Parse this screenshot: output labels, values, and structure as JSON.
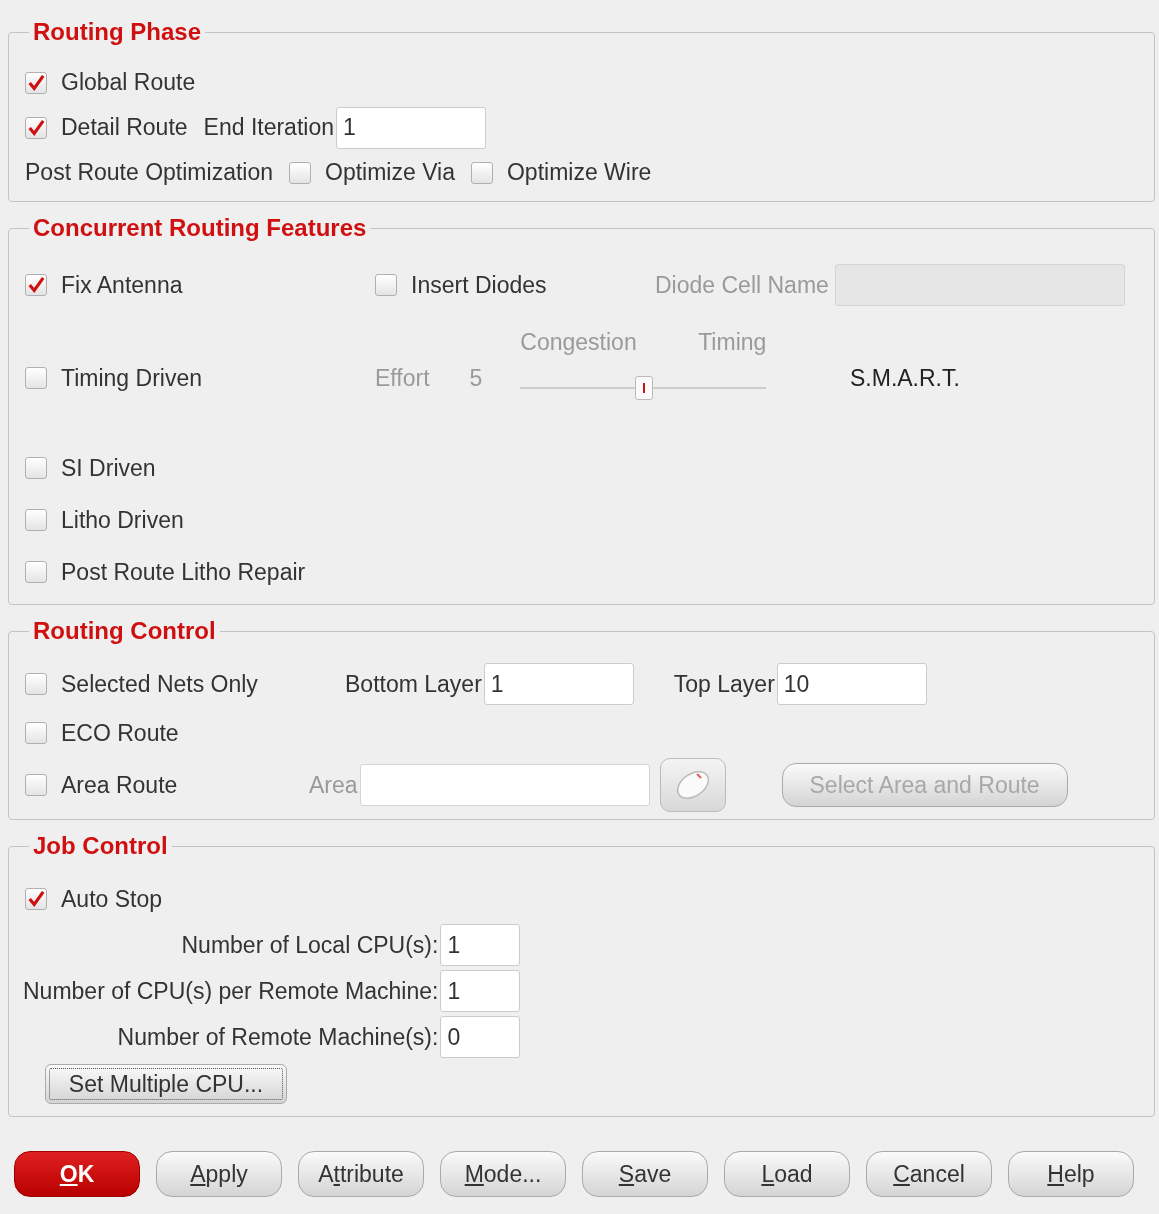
{
  "routing_phase": {
    "title": "Routing Phase",
    "global_route": {
      "label": "Global Route",
      "checked": true
    },
    "detail_route": {
      "label": "Detail Route",
      "checked": true
    },
    "end_iteration": {
      "label": "End Iteration",
      "value": "1"
    },
    "post_route_optimization": {
      "label": "Post Route Optimization"
    },
    "optimize_via": {
      "label": "Optimize Via",
      "checked": false
    },
    "optimize_wire": {
      "label": "Optimize Wire",
      "checked": false
    }
  },
  "concurrent_routing_features": {
    "title": "Concurrent Routing Features",
    "fix_antenna": {
      "label": "Fix Antenna",
      "checked": true
    },
    "insert_diodes": {
      "label": "Insert Diodes",
      "checked": false
    },
    "diode_cell_name": {
      "label": "Diode Cell Name",
      "disabled": true
    },
    "timing_driven": {
      "label": "Timing Driven",
      "checked": false
    },
    "effort": {
      "label": "Effort",
      "value": "5",
      "disabled": true,
      "left_label": "Congestion",
      "right_label": "Timing",
      "level": 0.5
    },
    "smart": "S.M.A.R.T.",
    "options": [
      {
        "label": "SI Driven",
        "checked": false
      },
      {
        "label": "Litho Driven",
        "checked": false
      },
      {
        "label": "Post Route Litho Repair",
        "checked": false
      }
    ]
  },
  "routing_control": {
    "title": "Routing Control",
    "selected_nets_only": {
      "label": "Selected Nets Only",
      "checked": false
    },
    "bottom_layer": {
      "label": "Bottom Layer",
      "value": "1"
    },
    "top_layer": {
      "label": "Top Layer",
      "value": "10"
    },
    "eco_route": {
      "label": "ECO Route",
      "checked": false
    },
    "area_route": {
      "label": "Area Route",
      "checked": false
    },
    "area": {
      "label": "Area",
      "disabled": true
    },
    "select_area_and_route": {
      "label": "Select Area and Route",
      "disabled": true
    }
  },
  "job_control": {
    "title": "Job Control",
    "auto_stop": {
      "label": "Auto Stop",
      "checked": true
    },
    "fields": [
      {
        "label": "Number of Local CPU(s):",
        "value": "1"
      },
      {
        "label": "Number of CPU(s) per Remote Machine:",
        "value": "1"
      },
      {
        "label": "Number of Remote Machine(s):",
        "value": "0"
      }
    ],
    "set_multiple_cpu": "Set Multiple CPU..."
  },
  "buttons": [
    {
      "key": "O",
      "post": "K",
      "kind": "primary"
    },
    {
      "key": "A",
      "post": "pply",
      "kind": "normal"
    },
    {
      "pre": "A",
      "key": "t",
      "post": "tribute",
      "kind": "normal"
    },
    {
      "key": "M",
      "post": "ode...",
      "kind": "normal"
    },
    {
      "key": "S",
      "post": "ave",
      "kind": "normal"
    },
    {
      "key": "L",
      "post": "oad",
      "kind": "normal"
    },
    {
      "key": "C",
      "post": "ancel",
      "kind": "normal"
    },
    {
      "key": "H",
      "post": "elp",
      "kind": "normal"
    }
  ]
}
